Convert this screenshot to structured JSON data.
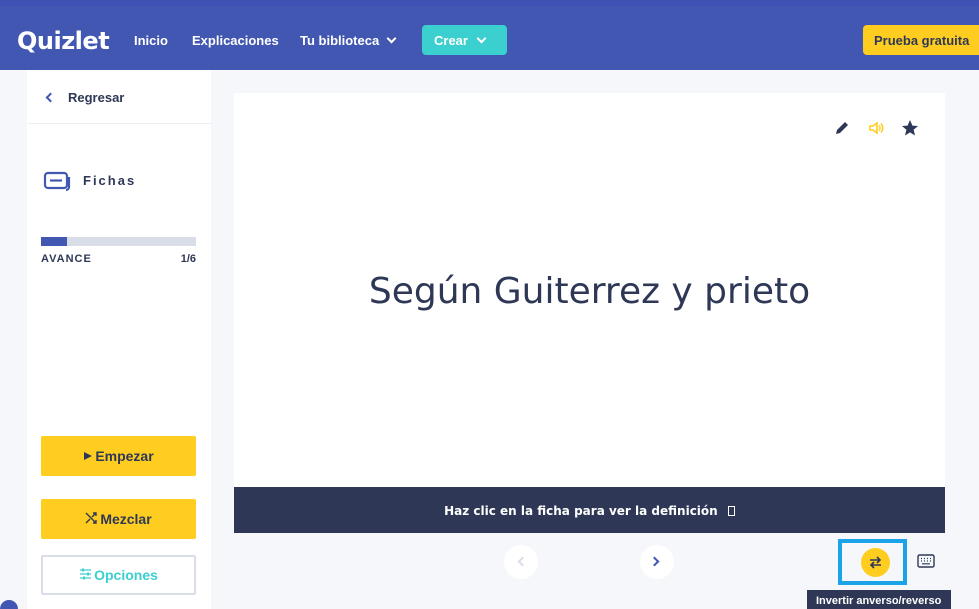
{
  "header": {
    "logo": "Quizlet",
    "nav": [
      "Inicio",
      "Explicaciones",
      "Tu biblioteca"
    ],
    "create_label": "Crear",
    "trial_label": "Prueba gratuita"
  },
  "sidebar": {
    "back_label": "Regresar",
    "mode_label": "Fichas",
    "progress_label": "AVANCE",
    "progress_count": "1/6",
    "progress_fraction": 0.17,
    "start_label": "Empezar",
    "shuffle_label": "Mezclar",
    "options_label": "Opciones"
  },
  "card": {
    "term": "Según Guiterrez y prieto",
    "hint": "Haz clic en la ficha para ver la definición"
  },
  "controls": {
    "tooltip": "Invertir anverso/reverso"
  },
  "icons": [
    "edit-icon",
    "audio-icon",
    "star-icon",
    "cards-icon",
    "play-icon",
    "shuffle-icon",
    "options-icon",
    "swap-icon",
    "keyboard-icon"
  ],
  "colors": {
    "brand": "#4257b2",
    "yellow": "#ffcd1f",
    "teal": "#3ccfcf",
    "dark": "#2e3856",
    "highlight": "#1aa3e8"
  }
}
